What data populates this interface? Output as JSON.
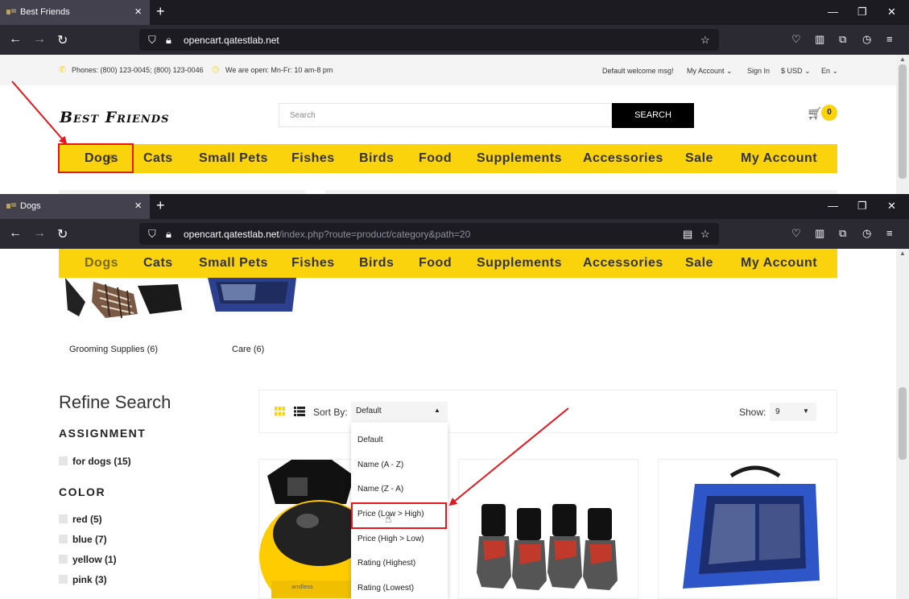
{
  "window1": {
    "tab_title": "Best Friends",
    "url_host": "opencart.qatestlab.net",
    "url_path": ""
  },
  "window2": {
    "tab_title": "Dogs",
    "url_host": "opencart.qatestlab.net",
    "url_path": "/index.php?route=product/category&path=20"
  },
  "topinfo": {
    "phones": "Phones: (800) 123-0045; (800) 123-0046",
    "hours": "We are open: Mn-Fr: 10 am-8 pm",
    "welcome": "Default welcome msg!",
    "my_account": "My Account",
    "sign_in": "Sign In",
    "currency": "$ USD",
    "language": "En"
  },
  "header": {
    "logo": "Best Friends",
    "search_placeholder": "Search",
    "search_button": "SEARCH",
    "cart_count": "0"
  },
  "menu": [
    "Dogs",
    "Cats",
    "Small Pets",
    "Fishes",
    "Birds",
    "Food",
    "Supplements",
    "Accessories",
    "Sale",
    "My Account"
  ],
  "subcategories": [
    "Grooming Supplies (6)",
    "Care (6)"
  ],
  "refine": {
    "title": "Refine Search",
    "assignment_heading": "ASSIGNMENT",
    "assignment_items": [
      "for dogs (15)"
    ],
    "color_heading": "COLOR",
    "color_items": [
      "red (5)",
      "blue (7)",
      "yellow (1)",
      "pink (3)"
    ]
  },
  "toolbar": {
    "sort_label": "Sort By:",
    "sort_value": "Default",
    "show_label": "Show:",
    "show_value": "9",
    "sort_options": [
      "Default",
      "Name (A - Z)",
      "Name (Z - A)",
      "Price (Low > High)",
      "Price (High > Low)",
      "Rating (Highest)",
      "Rating (Lowest)"
    ]
  },
  "colors": {
    "accent_yellow": "#fbd30d",
    "annotation_red": "#e3171c",
    "browser_dark": "#1c1b22"
  }
}
